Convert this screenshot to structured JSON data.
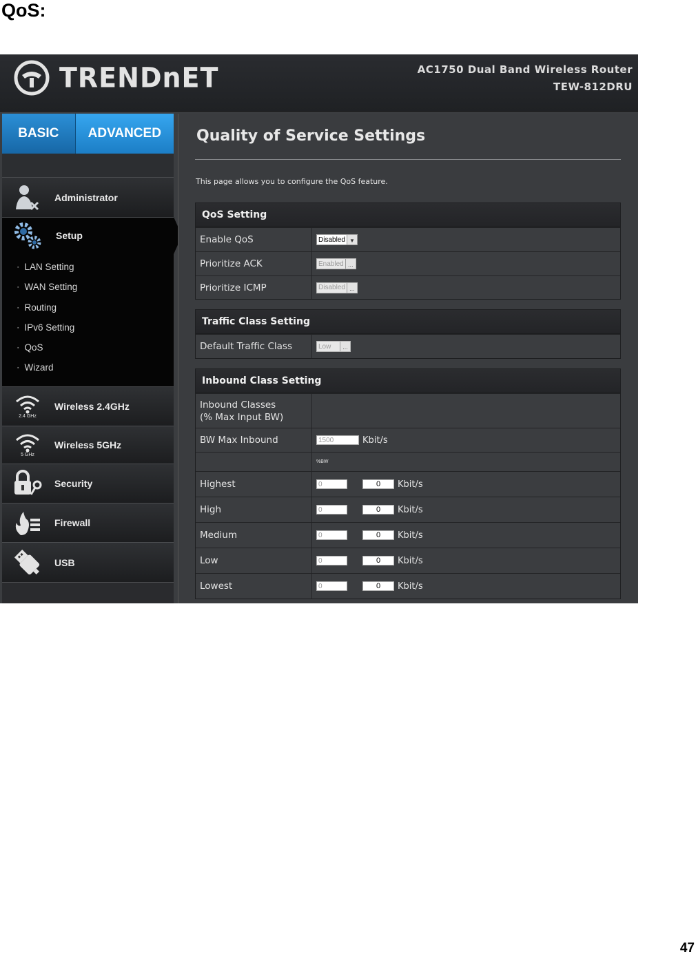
{
  "doc": {
    "heading": "QoS:",
    "page_number": "47"
  },
  "header": {
    "logo_text": "TRENDnET",
    "product_line1": "AC1750 Dual Band Wireless Router",
    "product_line2": "TEW-812DRU"
  },
  "tabs": {
    "basic": "BASIC",
    "advanced": "ADVANCED"
  },
  "nav": {
    "administrator": "Administrator",
    "setup": "Setup",
    "setup_sub": [
      "LAN Setting",
      "WAN Setting",
      "Routing",
      "IPv6 Setting",
      "QoS",
      "Wizard"
    ],
    "wireless24": "Wireless 2.4GHz",
    "wireless24_badge": "2.4 GHz",
    "wireless5": "Wireless 5GHz",
    "wireless5_badge": "5 GHz",
    "security": "Security",
    "firewall": "Firewall",
    "usb": "USB"
  },
  "main": {
    "title": "Quality of Service Settings",
    "description": "This page allows you to configure the QoS feature."
  },
  "qos_setting": {
    "title": "QoS Setting",
    "rows": [
      {
        "label": "Enable QoS",
        "value": "Disabled"
      },
      {
        "label": "Prioritize ACK",
        "value": "Enabled"
      },
      {
        "label": "Prioritize ICMP",
        "value": "Disabled"
      }
    ]
  },
  "traffic_class": {
    "title": "Traffic Class Setting",
    "label": "Default Traffic Class",
    "value": "Low"
  },
  "inbound": {
    "title": "Inbound Class Setting",
    "header_line1": "Inbound Classes",
    "header_line2": "(% Max Input BW)",
    "bw_label": "BW Max Inbound",
    "bw_value": "1500",
    "unit": "Kbit/s",
    "pct_label": "%BW",
    "classes": [
      {
        "label": "Highest",
        "pct": "0",
        "kbit": "0"
      },
      {
        "label": "High",
        "pct": "0",
        "kbit": "0"
      },
      {
        "label": "Medium",
        "pct": "0",
        "kbit": "0"
      },
      {
        "label": "Low",
        "pct": "0",
        "kbit": "0"
      },
      {
        "label": "Lowest",
        "pct": "0",
        "kbit": "0"
      }
    ]
  }
}
